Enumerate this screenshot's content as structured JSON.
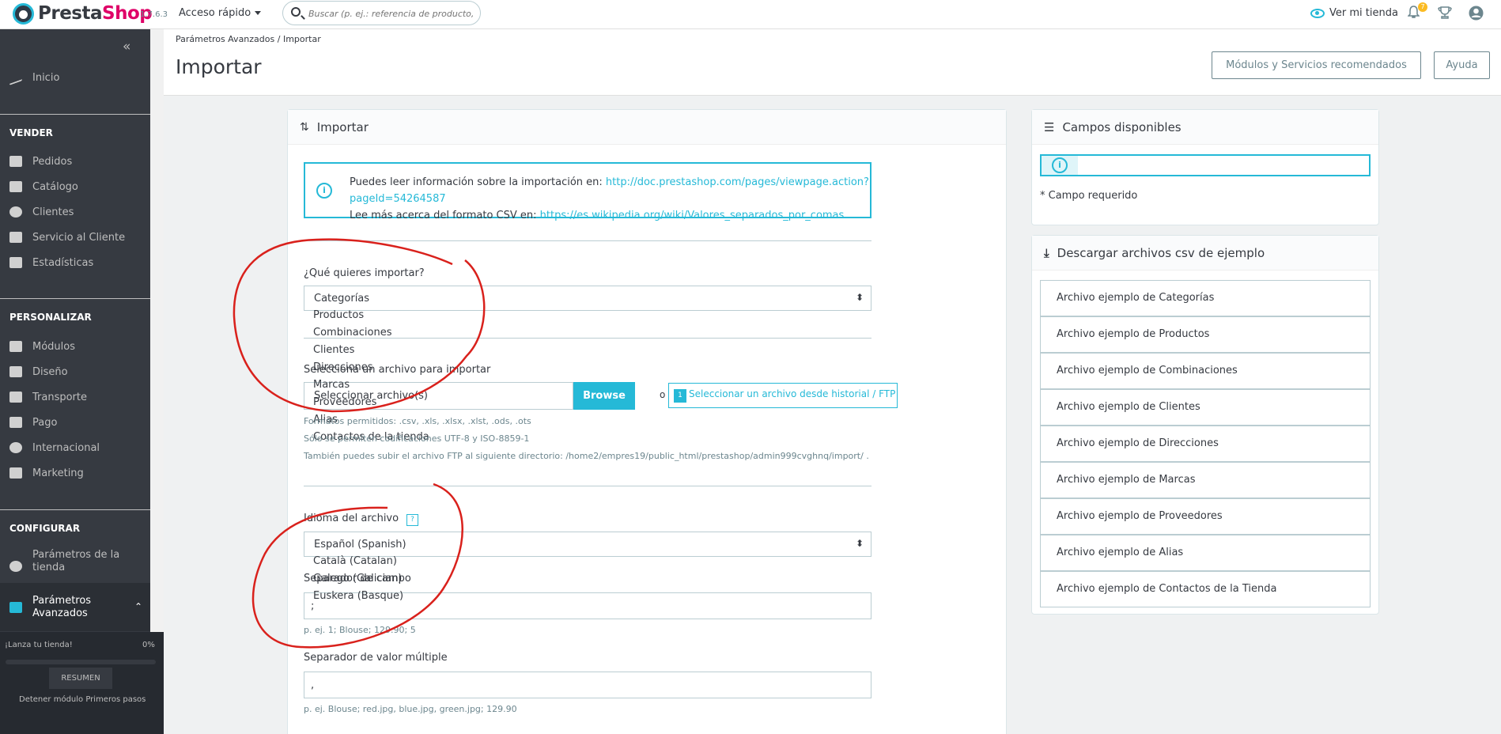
{
  "header": {
    "brand_a": "Presta",
    "brand_b": "Shop",
    "version": "1.7.6.3",
    "quick_access": "Acceso rápido",
    "search_placeholder": "Buscar (p. ej.: referencia de producto, no",
    "view_store": "Ver mi tienda",
    "notif_count": "7"
  },
  "sidebar": {
    "home": "Inicio",
    "sell_title": "VENDER",
    "sell_items": [
      "Pedidos",
      "Catálogo",
      "Clientes",
      "Servicio al Cliente",
      "Estadísticas"
    ],
    "custom_title": "PERSONALIZAR",
    "custom_items": [
      "Módulos",
      "Diseño",
      "Transporte",
      "Pago",
      "Internacional",
      "Marketing"
    ],
    "config_title": "CONFIGURAR",
    "config_items": [
      {
        "label1": "Parámetros de la",
        "label2": "tienda"
      },
      {
        "label1": "Parámetros",
        "label2": "Avanzados"
      }
    ],
    "onboarding": {
      "text": "¡Lanza tu tienda!",
      "percent": "0%",
      "progress": 0,
      "button": "RESUMEN",
      "stop": "Detener módulo Primeros pasos"
    }
  },
  "page": {
    "breadcrumb_a": "Parámetros Avanzados",
    "breadcrumb_sep": "/",
    "breadcrumb_b": "Importar",
    "title": "Importar",
    "btn_modules": "Módulos y Servicios recomendados",
    "btn_help": "Ayuda"
  },
  "import": {
    "panel_title": "Importar",
    "info_line1_text": "Puedes leer información sobre la importación en: ",
    "info_line1_link": "http://doc.prestashop.com/pages/viewpage.action?pageId=54264587",
    "info_line2_text": "Lee más acerca del formato CSV en: ",
    "info_line2_link": "https://es.wikipedia.org/wiki/Valores_separados_por_comas",
    "what_label": "¿Qué quieres importar?",
    "what_selected": "Categorías",
    "what_options": [
      "Productos",
      "Combinaciones",
      "Clientes",
      "Direcciones",
      "Marcas",
      "Proveedores",
      "Alias",
      "Contactos de la tienda"
    ],
    "file_label": "Selecciona un archivo para importar",
    "file_placeholder": "Seleccionar archivo(s)",
    "browse": "Browse",
    "or": "o",
    "history_num": "1",
    "history": "Seleccionar un archivo desde historial / FTP",
    "formats": "Formatos permitidos: .csv, .xls, .xlsx, .xlst, .ods, .ots",
    "encodings": "Sólo se permiten codificaciones UTF-8 y ISO-8859-1",
    "ftp": "También puedes subir el archivo FTP al siguiente directorio: /home2/empres19/public_html/prestashop/admin999cvghnq/import/ .",
    "lang_label": "Idioma del archivo",
    "lang_help": "?",
    "lang_selected": "Español (Spanish)",
    "lang_options": [
      "Català (Catalan)",
      "Galego (Galician)",
      "Euskera (Basque)"
    ],
    "field_sep_label": "Separador de campo",
    "field_sep_value": ";",
    "field_sep_hint": "p. ej. 1; Blouse; 129.90; 5",
    "multi_sep_label": "Separador de valor múltiple",
    "multi_sep_value": ",",
    "multi_sep_hint": "p. ej. Blouse; red.jpg, blue.jpg, green.jpg; 129.90"
  },
  "fields_panel": {
    "title": "Campos disponibles",
    "required_note": "* Campo requerido"
  },
  "samples_panel": {
    "title": "Descargar archivos csv de ejemplo",
    "items": [
      "Archivo ejemplo de Categorías",
      "Archivo ejemplo de Productos",
      "Archivo ejemplo de Combinaciones",
      "Archivo ejemplo de Clientes",
      "Archivo ejemplo de Direcciones",
      "Archivo ejemplo de Marcas",
      "Archivo ejemplo de Proveedores",
      "Archivo ejemplo de Alias",
      "Archivo ejemplo de Contactos de la Tienda"
    ]
  },
  "colors": {
    "accent": "#25b9d7",
    "brand_pink": "#df0067",
    "sidebar": "#363a41",
    "annotation": "#d9211c"
  }
}
